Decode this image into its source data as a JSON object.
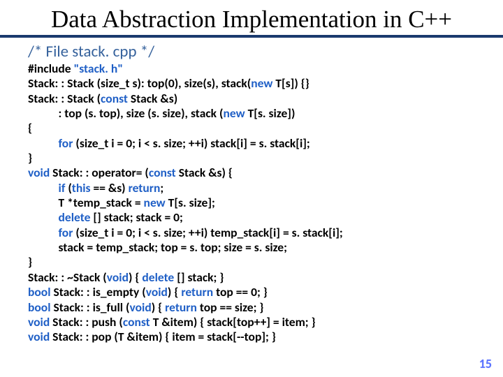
{
  "title": "Data Abstraction Implementation in C++",
  "file_heading": "/* File stack. cpp */",
  "code": {
    "l1a": "#include ",
    "l1b": "\"stack. h\"",
    "l2a": "Stack: : Stack (size_t s): top(0), size(s), stack(",
    "l2b": "new ",
    "l2c": "T[s]) {}",
    "l3a": "Stack: : Stack (",
    "l3b": "const ",
    "l3c": "Stack &s)",
    "l4a": "           : top (s. top), size (s. size), stack (",
    "l4b": "new ",
    "l4c": "T[s. size])",
    "l5": "{",
    "l6a": "           ",
    "l6b": "for ",
    "l6c": "(size_t i = 0; i < s. size; ++i) stack[i] = s. stack[i];",
    "l7": "}",
    "l8a": "void ",
    "l8b": "Stack: : operator= (",
    "l8c": "const ",
    "l8d": "Stack &s) {",
    "l9a": "           ",
    "l9b": "if ",
    "l9c": "(",
    "l9d": "this ",
    "l9e": "== &s) ",
    "l9f": "return",
    "l9g": ";",
    "l10a": "           T *temp_stack = ",
    "l10b": "new ",
    "l10c": "T[s. size];",
    "l11a": "           ",
    "l11b": "delete ",
    "l11c": "[] stack; stack = 0;",
    "l12a": "           ",
    "l12b": "for ",
    "l12c": "(size_t i = 0; i < s. size; ++i) temp_stack[i] = s. stack[i];",
    "l13": "           stack = temp_stack; top = s. top; size = s. size;",
    "l14": "}",
    "l15a": "Stack: : ~Stack (",
    "l15b": "void",
    "l15c": ") { ",
    "l15d": "delete ",
    "l15e": "[] stack; }",
    "l16a": "bool ",
    "l16b": "Stack: : is_empty (",
    "l16c": "void",
    "l16d": ") { ",
    "l16e": "return ",
    "l16f": "top == 0; }",
    "l17a": "bool ",
    "l17b": "Stack: : is_full (",
    "l17c": "void",
    "l17d": ") { ",
    "l17e": "return ",
    "l17f": "top == size; }",
    "l18a": "void ",
    "l18b": "Stack: : push (",
    "l18c": "const ",
    "l18d": "T &item) { stack[top++] = item; }",
    "l19a": "void ",
    "l19b": "Stack: : pop (T &item) { item = stack[--top]; }"
  },
  "page_number": "15"
}
